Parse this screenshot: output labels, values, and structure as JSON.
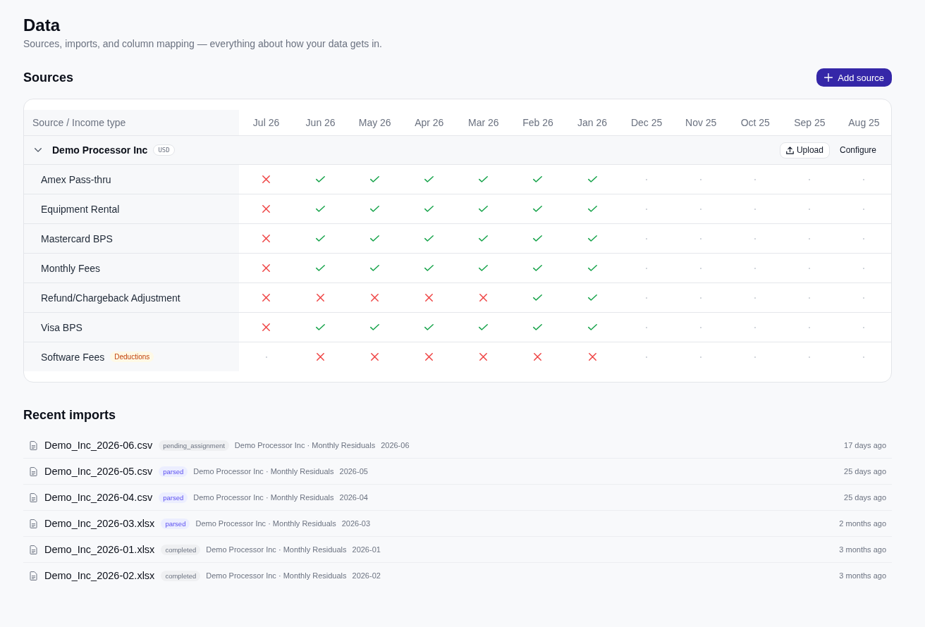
{
  "page": {
    "title": "Data",
    "subtitle": "Sources, imports, and column mapping — everything about how your data gets in."
  },
  "sources": {
    "title": "Sources",
    "add_button": "Add source",
    "table": {
      "first_column": "Source / Income type",
      "months": [
        "Jul 26",
        "Jun 26",
        "May 26",
        "Apr 26",
        "Mar 26",
        "Feb 26",
        "Jan 26",
        "Dec 25",
        "Nov 25",
        "Oct 25",
        "Sep 25",
        "Aug 25"
      ],
      "groups": [
        {
          "name": "Demo Processor Inc",
          "currency": "USD",
          "expanded": true,
          "upload_button": "Upload",
          "configure_button": "Configure",
          "rows": [
            {
              "name": "Amex Pass-thru",
              "cells": [
                {
                  "kind": "missing"
                },
                {
                  "kind": "received"
                },
                {
                  "kind": "received"
                },
                {
                  "kind": "received"
                },
                {
                  "kind": "received"
                },
                {
                  "kind": "received"
                },
                {
                  "kind": "received"
                },
                {
                  "kind": "empty"
                },
                {
                  "kind": "empty"
                },
                {
                  "kind": "empty"
                },
                {
                  "kind": "empty"
                },
                {
                  "kind": "empty"
                }
              ]
            },
            {
              "name": "Equipment Rental",
              "cells": [
                {
                  "kind": "missing"
                },
                {
                  "kind": "received"
                },
                {
                  "kind": "received"
                },
                {
                  "kind": "received"
                },
                {
                  "kind": "received"
                },
                {
                  "kind": "received"
                },
                {
                  "kind": "received"
                },
                {
                  "kind": "empty"
                },
                {
                  "kind": "empty"
                },
                {
                  "kind": "empty"
                },
                {
                  "kind": "empty"
                },
                {
                  "kind": "empty"
                }
              ]
            },
            {
              "name": "Mastercard BPS",
              "cells": [
                {
                  "kind": "missing"
                },
                {
                  "kind": "received"
                },
                {
                  "kind": "received"
                },
                {
                  "kind": "received"
                },
                {
                  "kind": "received"
                },
                {
                  "kind": "received"
                },
                {
                  "kind": "received"
                },
                {
                  "kind": "empty"
                },
                {
                  "kind": "empty"
                },
                {
                  "kind": "empty"
                },
                {
                  "kind": "empty"
                },
                {
                  "kind": "empty"
                }
              ]
            },
            {
              "name": "Monthly Fees",
              "cells": [
                {
                  "kind": "missing"
                },
                {
                  "kind": "received"
                },
                {
                  "kind": "received"
                },
                {
                  "kind": "received"
                },
                {
                  "kind": "received"
                },
                {
                  "kind": "received"
                },
                {
                  "kind": "received"
                },
                {
                  "kind": "empty"
                },
                {
                  "kind": "empty"
                },
                {
                  "kind": "empty"
                },
                {
                  "kind": "empty"
                },
                {
                  "kind": "empty"
                }
              ]
            },
            {
              "name": "Refund/Chargeback Adjustment",
              "cells": [
                {
                  "kind": "missing"
                },
                {
                  "kind": "missing"
                },
                {
                  "kind": "missing"
                },
                {
                  "kind": "missing"
                },
                {
                  "kind": "missing"
                },
                {
                  "kind": "received"
                },
                {
                  "kind": "received"
                },
                {
                  "kind": "empty"
                },
                {
                  "kind": "empty"
                },
                {
                  "kind": "empty"
                },
                {
                  "kind": "empty"
                },
                {
                  "kind": "empty"
                }
              ]
            },
            {
              "name": "Visa BPS",
              "cells": [
                {
                  "kind": "missing"
                },
                {
                  "kind": "received"
                },
                {
                  "kind": "received"
                },
                {
                  "kind": "received"
                },
                {
                  "kind": "received"
                },
                {
                  "kind": "received"
                },
                {
                  "kind": "received"
                },
                {
                  "kind": "empty"
                },
                {
                  "kind": "empty"
                },
                {
                  "kind": "empty"
                },
                {
                  "kind": "empty"
                },
                {
                  "kind": "empty"
                }
              ]
            },
            {
              "name": "Software Fees",
              "tag": "Deductions",
              "cells": [
                {
                  "kind": "empty"
                },
                {
                  "kind": "missing"
                },
                {
                  "kind": "missing"
                },
                {
                  "kind": "missing"
                },
                {
                  "kind": "missing"
                },
                {
                  "kind": "missing"
                },
                {
                  "kind": "missing"
                },
                {
                  "kind": "empty"
                },
                {
                  "kind": "empty"
                },
                {
                  "kind": "empty"
                },
                {
                  "kind": "empty"
                },
                {
                  "kind": "empty"
                }
              ]
            }
          ]
        }
      ]
    }
  },
  "recent_imports": {
    "title": "Recent imports",
    "items": [
      {
        "file": "Demo_Inc_2026-06.csv",
        "badge": {
          "label": "pending_assignment",
          "kind": "neutral"
        },
        "source": "Demo Processor Inc · Monthly Residuals",
        "period": "2026-06",
        "time": "17 days ago"
      },
      {
        "file": "Demo_Inc_2026-05.csv",
        "badge": {
          "label": "parsed",
          "kind": "accent"
        },
        "source": "Demo Processor Inc · Monthly Residuals",
        "period": "2026-05",
        "time": "25 days ago"
      },
      {
        "file": "Demo_Inc_2026-04.csv",
        "badge": {
          "label": "parsed",
          "kind": "accent"
        },
        "source": "Demo Processor Inc · Monthly Residuals",
        "period": "2026-04",
        "time": "25 days ago"
      },
      {
        "file": "Demo_Inc_2026-03.xlsx",
        "badge": {
          "label": "parsed",
          "kind": "accent"
        },
        "source": "Demo Processor Inc · Monthly Residuals",
        "period": "2026-03",
        "time": "2 months ago"
      },
      {
        "file": "Demo_Inc_2026-01.xlsx",
        "badge": {
          "label": "completed",
          "kind": "neutral"
        },
        "source": "Demo Processor Inc · Monthly Residuals",
        "period": "2026-01",
        "time": "3 months ago"
      },
      {
        "file": "Demo_Inc_2026-02.xlsx",
        "badge": {
          "label": "completed",
          "kind": "neutral"
        },
        "source": "Demo Processor Inc · Monthly Residuals",
        "period": "2026-02",
        "time": "3 months ago"
      }
    ]
  }
}
